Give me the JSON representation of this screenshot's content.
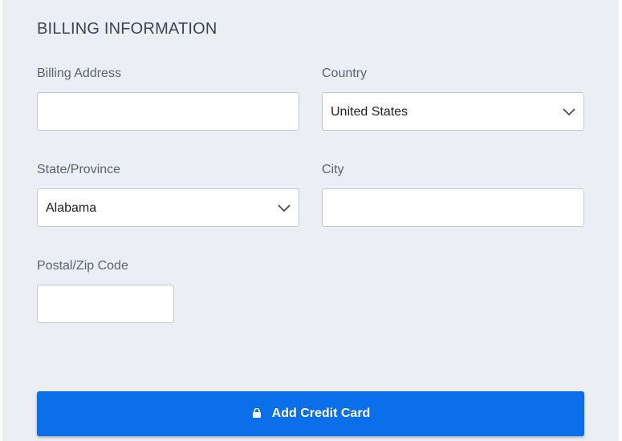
{
  "section": {
    "title": "BILLING INFORMATION"
  },
  "fields": {
    "billing_address": {
      "label": "Billing Address",
      "value": ""
    },
    "country": {
      "label": "Country",
      "value": "United States"
    },
    "state": {
      "label": "State/Province",
      "value": "Alabama"
    },
    "city": {
      "label": "City",
      "value": ""
    },
    "postal": {
      "label": "Postal/Zip Code",
      "value": ""
    }
  },
  "actions": {
    "add_card_label": "Add Credit Card",
    "add_card_icon": "lock-icon"
  },
  "colors": {
    "background": "#ebeef2",
    "primary_button": "#0a6fe8",
    "field_border": "#c3c8cf"
  }
}
